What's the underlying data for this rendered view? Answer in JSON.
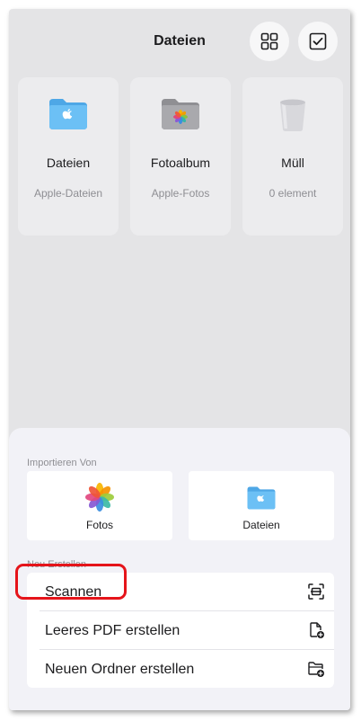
{
  "header": {
    "title": "Dateien"
  },
  "cards": [
    {
      "name": "Dateien",
      "subtitle": "Apple-Dateien",
      "icon": "blue-folder-icon"
    },
    {
      "name": "Fotoalbum",
      "subtitle": "Apple-Fotos",
      "icon": "photos-folder-icon"
    },
    {
      "name": "Müll",
      "subtitle": "0 element",
      "icon": "trash-icon"
    }
  ],
  "sheet": {
    "import_label": "Importieren Von",
    "import_tiles": [
      {
        "label": "Fotos",
        "icon": "photos-app-icon"
      },
      {
        "label": "Dateien",
        "icon": "files-folder-icon"
      }
    ],
    "create_label": "Neu Erstellen",
    "create_items": [
      {
        "label": "Scannen",
        "icon": "scan-icon"
      },
      {
        "label": "Leeres PDF erstellen",
        "icon": "new-document-icon"
      },
      {
        "label": "Neuen Ordner erstellen",
        "icon": "new-folder-icon"
      }
    ]
  },
  "colors": {
    "highlight": "#e5141a",
    "folder_blue": "#5ab4ee",
    "muted_text": "#8e8e93"
  }
}
